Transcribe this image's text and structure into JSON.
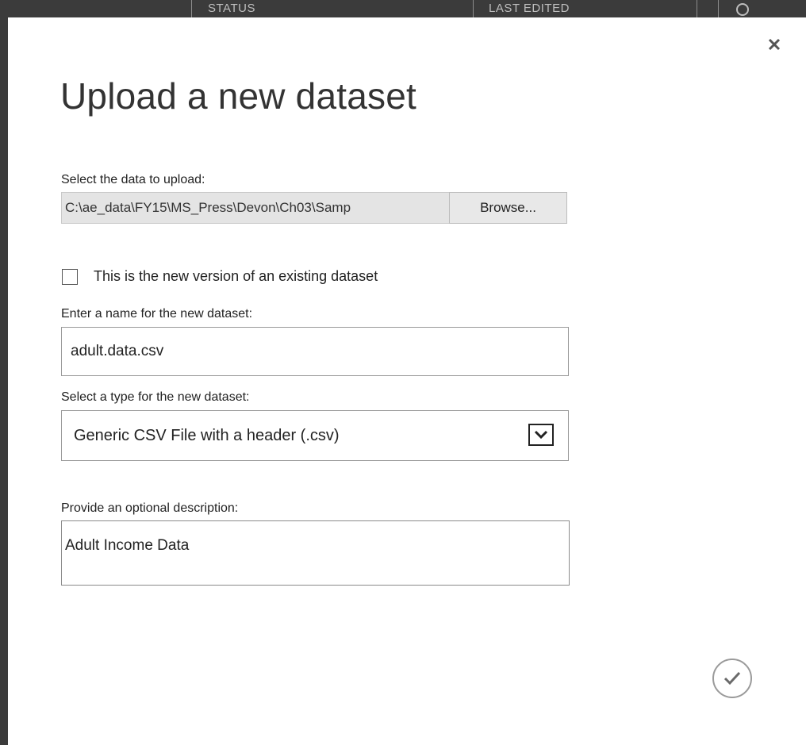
{
  "background": {
    "columns": [
      "STATUS",
      "LAST EDITED"
    ]
  },
  "dialog": {
    "title": "Upload a new dataset",
    "close_icon": "close-icon",
    "file": {
      "label": "Select the data to upload:",
      "path": "C:\\ae_data\\FY15\\MS_Press\\Devon\\Ch03\\Samp",
      "browse_label": "Browse..."
    },
    "new_version": {
      "label": "This is the new version of an existing dataset",
      "checked": false
    },
    "name": {
      "label": "Enter a name for the new dataset:",
      "value": "adult.data.csv"
    },
    "type": {
      "label": "Select a type for the new dataset:",
      "selected": "Generic CSV File with a header (.csv)",
      "arrow_icon": "chevron-down-icon"
    },
    "description": {
      "label": "Provide an optional description:",
      "value": "Adult Income Data"
    },
    "confirm_icon": "checkmark-icon"
  }
}
